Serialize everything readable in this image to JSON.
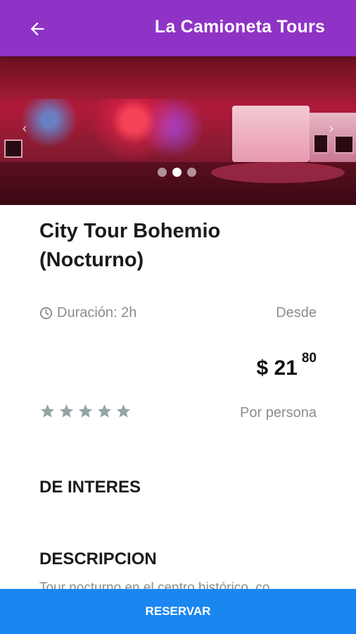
{
  "appbar": {
    "title": "La Camioneta Tours",
    "back_icon": "arrow-left-icon"
  },
  "hero": {
    "slide_count": 3,
    "active_slide": 2,
    "prev_icon": "chevron-left-icon",
    "next_icon": "chevron-right-icon"
  },
  "tour": {
    "title": "City Tour Bohemio (Nocturno)",
    "duration_label": "Duración: 2h",
    "duration_icon": "clock-icon",
    "desde_label": "Desde",
    "price_main": "$ 21",
    "price_cents": "80",
    "rating": 0,
    "rating_max": 5,
    "per_person_label": "Por persona"
  },
  "sections": {
    "interest_title": "DE INTERES",
    "description_title": "DESCRIPCION",
    "description_text": "Tour nocturno en el centro histórico, co"
  },
  "footer": {
    "reserve_label": "RESERVAR"
  },
  "colors": {
    "appbar": "#8e33c6",
    "reserve_button": "#1a86f0",
    "star": "#95a5a6"
  }
}
